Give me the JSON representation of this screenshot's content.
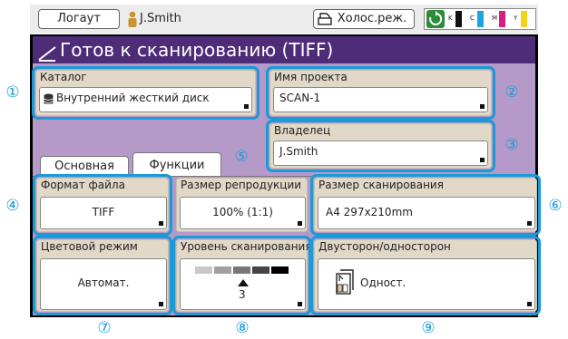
{
  "topbar": {
    "logout_label": "Логаут",
    "user_name": "J.Smith",
    "mode_label": "Холос.реж.",
    "inks": [
      {
        "letter": "K",
        "color": "#111111"
      },
      {
        "letter": "C",
        "color": "#1ba6e0"
      },
      {
        "letter": "M",
        "color": "#d61f86"
      },
      {
        "letter": "Y",
        "color": "#f2d21b"
      }
    ]
  },
  "title": "Готов к сканированию (TIFF)",
  "tabs": {
    "basic": "Основная",
    "functions": "Функции"
  },
  "catalog": {
    "label": "Каталог",
    "value": "Внутренний жесткий диск"
  },
  "project": {
    "label": "Имя проекта",
    "value": "SCAN-1"
  },
  "owner": {
    "label": "Владелец",
    "value": "J.Smith"
  },
  "file_format": {
    "label": "Формат файла",
    "value": "TIFF"
  },
  "repro_size": {
    "label": "Размер репродукции",
    "value": "100% (1:1)"
  },
  "scan_size": {
    "label": "Размер сканирования",
    "value": "A4 297x210mm"
  },
  "color_mode": {
    "label": "Цветовой режим",
    "value": "Автомат."
  },
  "scan_level": {
    "label": "Уровень сканирования",
    "value": "3"
  },
  "duplex": {
    "label": "Двусторон/односторон",
    "value": "Одност."
  },
  "callouts": [
    "①",
    "②",
    "③",
    "④",
    "⑤",
    "⑥",
    "⑦",
    "⑧",
    "⑨"
  ],
  "colors": {
    "title_bg": "#4e2c78",
    "content_bg": "#b59ac9",
    "panel_bg": "#e2d8c8",
    "highlight": "#1a9ad6"
  }
}
